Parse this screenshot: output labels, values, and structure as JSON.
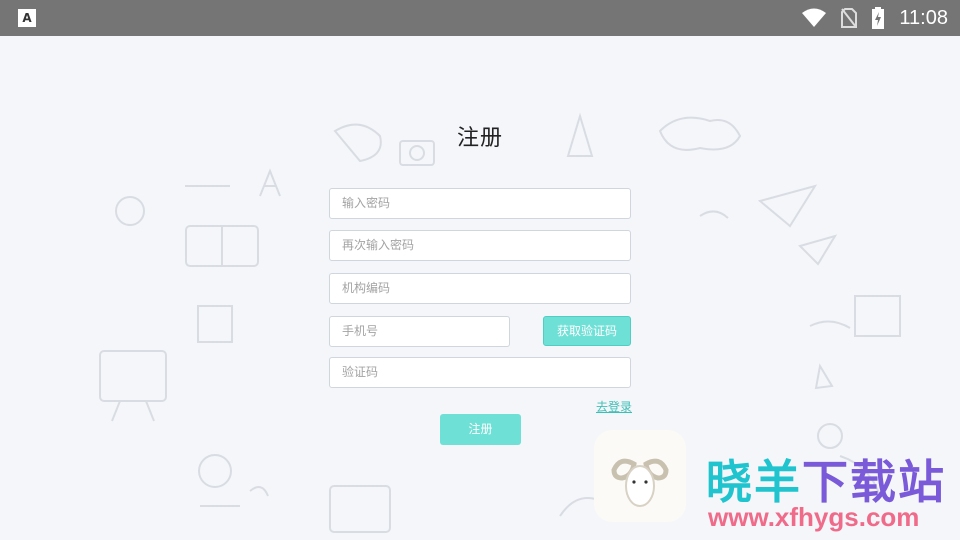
{
  "status_bar": {
    "left_icon": "A",
    "time": "11:08",
    "icons": [
      "wifi-icon",
      "no-sim-icon",
      "battery-charging-icon"
    ]
  },
  "form": {
    "title": "注册",
    "password_placeholder": "输入密码",
    "password_confirm_placeholder": "再次输入密码",
    "org_code_placeholder": "机构编码",
    "phone_placeholder": "手机号",
    "get_code_label": "获取验证码",
    "code_placeholder": "验证码",
    "go_login_label": "去登录",
    "register_label": "注册"
  },
  "watermark": {
    "name_part1": "晓羊",
    "name_part2": "下载站",
    "url": "www.xfhygs.com"
  },
  "colors": {
    "accent": "#6fe0d6",
    "link": "#3dbfb6",
    "statusbar": "#757575",
    "background": "#f4f6f9"
  }
}
